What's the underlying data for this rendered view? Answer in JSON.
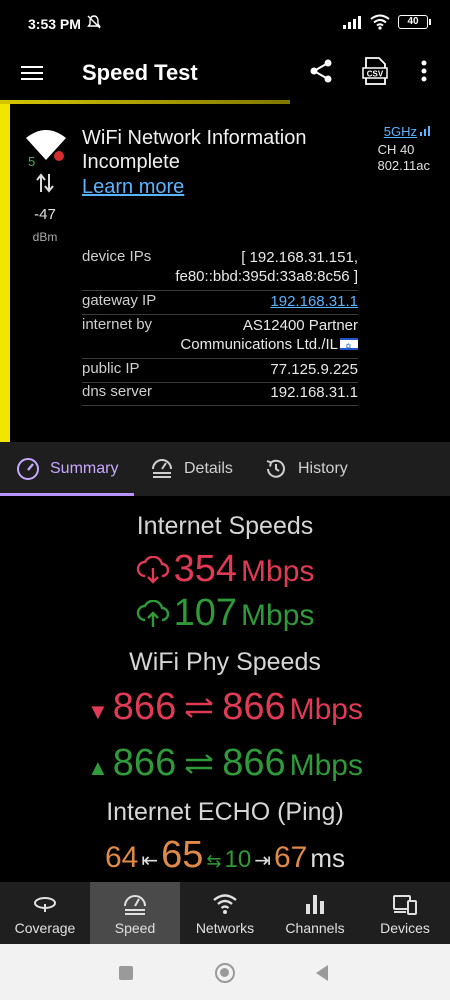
{
  "status_bar": {
    "time": "3:53 PM",
    "battery": "40",
    "icons": [
      "mute-icon",
      "signal-icon",
      "wifi-icon",
      "battery-icon"
    ]
  },
  "app_bar": {
    "title": "Speed Test",
    "icons": [
      "menu-icon",
      "share-icon",
      "csv-icon",
      "more-icon"
    ]
  },
  "wifi_info": {
    "message": "WiFi Network Information Incomplete",
    "learn_more": "Learn more",
    "signal_badge": "5",
    "rssi": "-47",
    "rssi_unit": "dBm",
    "band": "5GHz",
    "channel": "CH 40",
    "standard": "802.11ac",
    "rows": [
      {
        "key": "device IPs",
        "value": "[ 192.168.31.151,",
        "value2": "fe80::bbd:395d:33a8:8c56 ]"
      },
      {
        "key": "gateway IP",
        "value": "192.168.31.1"
      },
      {
        "key": "internet by",
        "value": "AS12400 Partner",
        "value2": "Communications Ltd./IL"
      },
      {
        "key": "public IP",
        "value": "77.125.9.225"
      },
      {
        "key": "dns server",
        "value": "192.168.31.1"
      }
    ]
  },
  "tabs": [
    {
      "label": "Summary",
      "icon": "gauge-icon",
      "active": true
    },
    {
      "label": "Details",
      "icon": "details-icon",
      "active": false
    },
    {
      "label": "History",
      "icon": "history-icon",
      "active": false
    }
  ],
  "summary": {
    "internet_speeds_title": "Internet Speeds",
    "download": {
      "value": "354",
      "unit": "Mbps"
    },
    "upload": {
      "value": "107",
      "unit": "Mbps"
    },
    "phy_title": "WiFi Phy Speeds",
    "phy_down": {
      "value1": "866",
      "value2": "866",
      "unit": "Mbps"
    },
    "phy_up": {
      "value1": "866",
      "value2": "866",
      "unit": "Mbps"
    },
    "ping_title": "Internet ECHO (Ping)",
    "ping": {
      "min": "64",
      "avg": "65",
      "jitter": "10",
      "max": "67",
      "unit": "ms"
    }
  },
  "bottom_nav": [
    {
      "label": "Coverage",
      "icon": "coverage-icon",
      "active": false
    },
    {
      "label": "Speed",
      "icon": "speedometer-icon",
      "active": true
    },
    {
      "label": "Networks",
      "icon": "wifi-icon",
      "active": false
    },
    {
      "label": "Channels",
      "icon": "bar-chart-icon",
      "active": false
    },
    {
      "label": "Devices",
      "icon": "devices-icon",
      "active": false
    }
  ],
  "colors": {
    "accent_tab": "#b794ff",
    "download": "#e03a55",
    "upload": "#2f9a3a",
    "ping": "#e08a4a",
    "link": "#5ab4ff",
    "quality_bar": "#f2e600"
  }
}
